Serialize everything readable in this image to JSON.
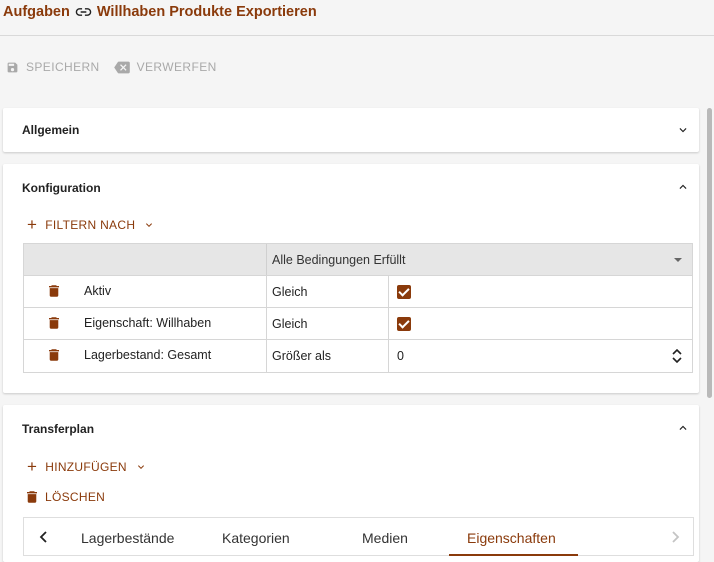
{
  "header": {
    "breadcrumb_parent": "Aufgaben",
    "breadcrumb_current": "Willhaben Produkte Exportieren"
  },
  "toolbar": {
    "save_label": "SPEICHERN",
    "discard_label": "VERWERFEN"
  },
  "panels": {
    "general": {
      "title": "Allgemein"
    },
    "config": {
      "title": "Konfiguration",
      "filter_label": "FILTERN NACH",
      "condition_mode": "Alle Bedingungen Erfüllt",
      "rows": [
        {
          "field": "Aktiv",
          "operator": "Gleich",
          "value_type": "checkbox",
          "checked": true
        },
        {
          "field": "Eigenschaft: Willhaben",
          "operator": "Gleich",
          "value_type": "checkbox",
          "checked": true
        },
        {
          "field": "Lagerbestand: Gesamt",
          "operator": "Größer als",
          "value_type": "number",
          "value": "0"
        }
      ]
    },
    "transfer": {
      "title": "Transferplan",
      "add_label": "HINZUFÜGEN",
      "delete_label": "LÖSCHEN",
      "tabs": [
        "Lagerbestände",
        "Kategorien",
        "Medien",
        "Eigenschaften"
      ],
      "active_tab": "Eigenschaften"
    }
  },
  "colors": {
    "accent": "#8a3a0b",
    "disabled": "#a9a9a9",
    "background": "#f5f5f5"
  },
  "icons": [
    "link-icon",
    "save-icon",
    "backspace-icon",
    "chevron-down-icon",
    "chevron-up-icon",
    "trash-icon",
    "plus-icon",
    "stepper-icon",
    "chevron-left-icon",
    "chevron-right-icon"
  ]
}
